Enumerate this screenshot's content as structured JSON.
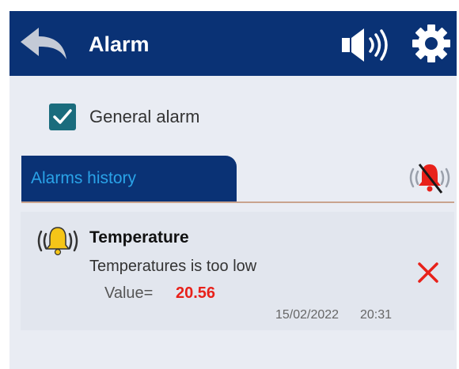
{
  "header": {
    "title": "Alarm",
    "back_icon": "back-arrow-icon",
    "sound_icon": "speaker-icon",
    "settings_icon": "gear-icon"
  },
  "general_alarm": {
    "label": "General alarm",
    "checked": true
  },
  "tabs": [
    {
      "label": "Alarms history",
      "active": true
    }
  ],
  "mute_icon": "bell-muted-icon",
  "alarms": [
    {
      "icon": "bell-ringing-icon",
      "title": "Temperature",
      "message": "Temperatures is too low",
      "value_label": "Value=",
      "value": "20.56",
      "date": "15/02/2022",
      "time": "20:31",
      "dismiss_icon": "close-icon"
    }
  ],
  "colors": {
    "header": "#0a3275",
    "accent": "#2aa3e8",
    "checkbox": "#1a6c7d",
    "alarm_value": "#e8211a",
    "bell": "#f5c518"
  }
}
